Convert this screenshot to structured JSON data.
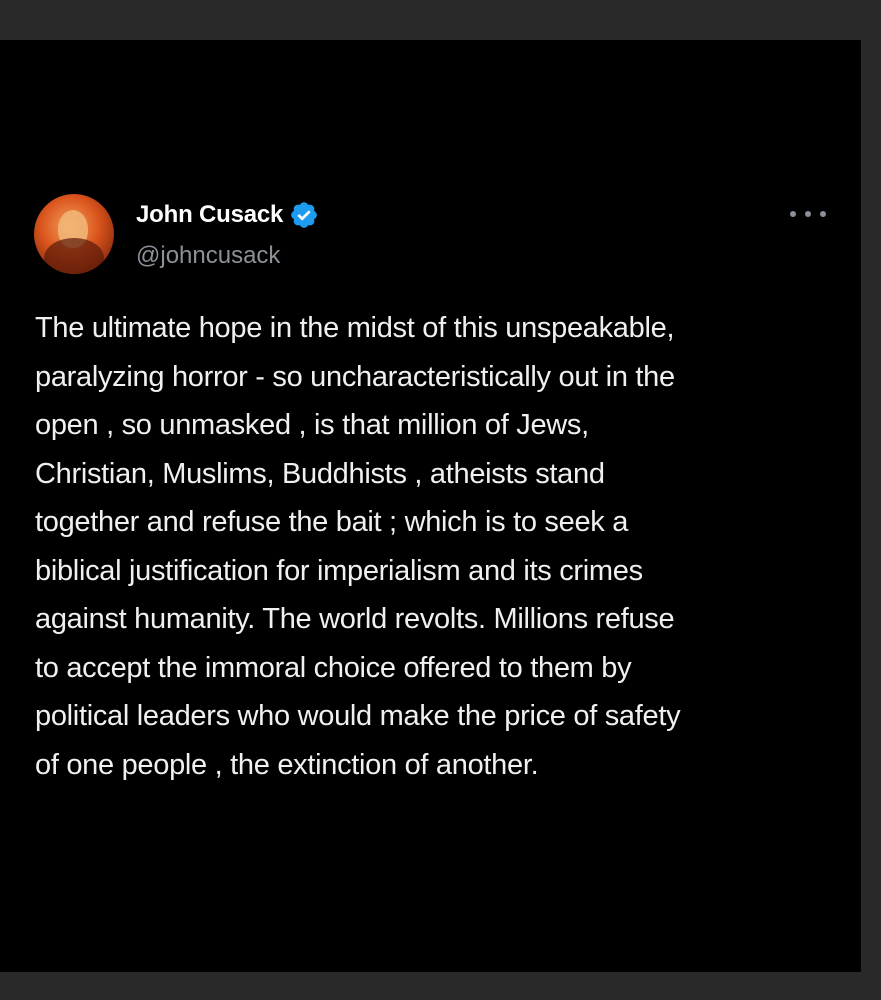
{
  "tweet": {
    "display_name": "John Cusack",
    "handle": "@johncusack",
    "verified": true,
    "body_lines": [
      "The ultimate hope in the midst of this unspeakable,",
      "paralyzing horror - so uncharacteristically out in the",
      "open , so unmasked , is that million of Jews,",
      "Christian, Muslims, Buddhists , atheists  stand",
      "together and refuse the bait ;  which is to seek a",
      "biblical justification for imperialism and its crimes",
      "against humanity.  The world revolts. Millions refuse",
      "to accept the immoral choice offered to them by",
      "political leaders who would make the price of safety",
      "of one people , the extinction of another."
    ]
  },
  "icons": {
    "verified": "verified-badge-icon",
    "more": "more-options-icon"
  },
  "colors": {
    "background": "#000000",
    "outer_frame": "#292929",
    "text_primary": "#eef0f2",
    "text_secondary": "#8b9198",
    "verified_blue": "#1d9bf0"
  }
}
